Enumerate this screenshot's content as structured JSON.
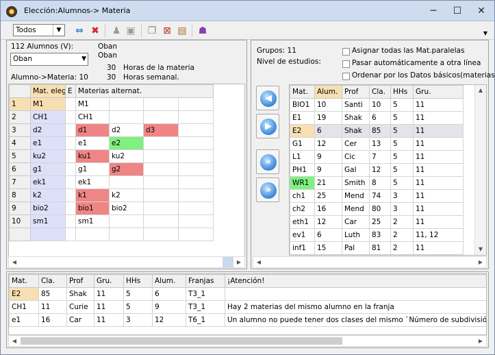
{
  "window": {
    "title": "Elección:Alumnos-> Materia",
    "minimize": "─",
    "maximize": "☐",
    "close": "✕"
  },
  "toolbar": {
    "filter_value": "Todos"
  },
  "left": {
    "alumnos_label": "112 Alumnos (V):",
    "teacher_select": "Oban",
    "teacher_name_1": "Oban",
    "teacher_name_2": "Oban",
    "alumno_materia_label": "Alumno->Materia: 10",
    "horas_materia_value": "30",
    "horas_materia_label": "Horas de la materia",
    "horas_semanal_value": "30",
    "horas_semanal_label": "Horas semanal.",
    "grid": {
      "h_mat": "Mat. eleg",
      "h_e": "E",
      "h_alt": "Materias alternat.",
      "rows": [
        {
          "n": "1",
          "mat": "M1",
          "e": "",
          "alt": [
            "M1",
            "",
            "",
            ""
          ]
        },
        {
          "n": "2",
          "mat": "CH1",
          "e": "",
          "alt": [
            "CH1",
            "",
            "",
            ""
          ]
        },
        {
          "n": "3",
          "mat": "d2",
          "e": "",
          "alt": [
            "d1",
            "d2",
            "d3",
            ""
          ]
        },
        {
          "n": "4",
          "mat": "e1",
          "e": "",
          "alt": [
            "e1",
            "e2",
            "",
            ""
          ]
        },
        {
          "n": "5",
          "mat": "ku2",
          "e": "",
          "alt": [
            "ku1",
            "ku2",
            "",
            ""
          ]
        },
        {
          "n": "6",
          "mat": "g1",
          "e": "",
          "alt": [
            "g1",
            "g2",
            "",
            ""
          ]
        },
        {
          "n": "7",
          "mat": "ek1",
          "e": "",
          "alt": [
            "ek1",
            "",
            "",
            ""
          ]
        },
        {
          "n": "8",
          "mat": "k2",
          "e": "",
          "alt": [
            "k1",
            "k2",
            "",
            ""
          ]
        },
        {
          "n": "9",
          "mat": "bio2",
          "e": "",
          "alt": [
            "bio1",
            "bio2",
            "",
            ""
          ]
        },
        {
          "n": "10",
          "mat": "sm1",
          "e": "",
          "alt": [
            "sm1",
            "",
            "",
            ""
          ]
        }
      ]
    }
  },
  "right": {
    "grupos_label": "Grupos: 11",
    "nivel_label": "Nivel de estudios:",
    "opt1": "Asignar todas las Mat.paralelas",
    "opt2": "Pasar automáticamente a otra línea",
    "opt3": "Ordenar por los Datos básicos(materias)",
    "grid": {
      "headers": [
        "Mat.",
        "Alum.",
        "Prof",
        "Cla.",
        "HHs",
        "Gru."
      ],
      "rows": [
        [
          "BIO1",
          "10",
          "Santi",
          "10",
          "5",
          "11"
        ],
        [
          "E1",
          "19",
          "Shak",
          "6",
          "5",
          "11"
        ],
        [
          "E2",
          "6",
          "Shak",
          "85",
          "5",
          "11"
        ],
        [
          "G1",
          "12",
          "Cer",
          "13",
          "5",
          "11"
        ],
        [
          "L1",
          "9",
          "Cic",
          "7",
          "5",
          "11"
        ],
        [
          "PH1",
          "9",
          "Gal",
          "12",
          "5",
          "11"
        ],
        [
          "WR1",
          "21",
          "Smith",
          "8",
          "5",
          "11"
        ],
        [
          "ch1",
          "25",
          "Mend",
          "74",
          "3",
          "11"
        ],
        [
          "ch2",
          "16",
          "Mend",
          "80",
          "3",
          "11"
        ],
        [
          "eth1",
          "12",
          "Car",
          "25",
          "2",
          "11"
        ],
        [
          "ev1",
          "6",
          "Luth",
          "83",
          "2",
          "11, 12"
        ],
        [
          "inf1",
          "15",
          "Pal",
          "81",
          "2",
          "11"
        ]
      ]
    }
  },
  "bottom": {
    "headers": [
      "Mat.",
      "Cla.",
      "Prof",
      "Gru.",
      "HHs",
      "Alum.",
      "Franjas",
      "¡Atención!"
    ],
    "rows": [
      [
        "E2",
        "85",
        "Shak",
        "11",
        "5",
        "6",
        "T3_1",
        ""
      ],
      [
        "CH1",
        "11",
        "Curie",
        "11",
        "5",
        "9",
        "T3_1",
        "Hay 2 materias del mismo alumno en la franja"
      ],
      [
        "e1",
        "16",
        "Car",
        "11",
        "3",
        "12",
        "T6_1",
        "Un alumno no puede tener dos clases del mismo `Número de subdivisión`."
      ]
    ]
  },
  "colors": {
    "selected": "#f8dfb3",
    "chosen": "#dde0f8",
    "conflict": "#f08585",
    "ok": "#80f080"
  }
}
